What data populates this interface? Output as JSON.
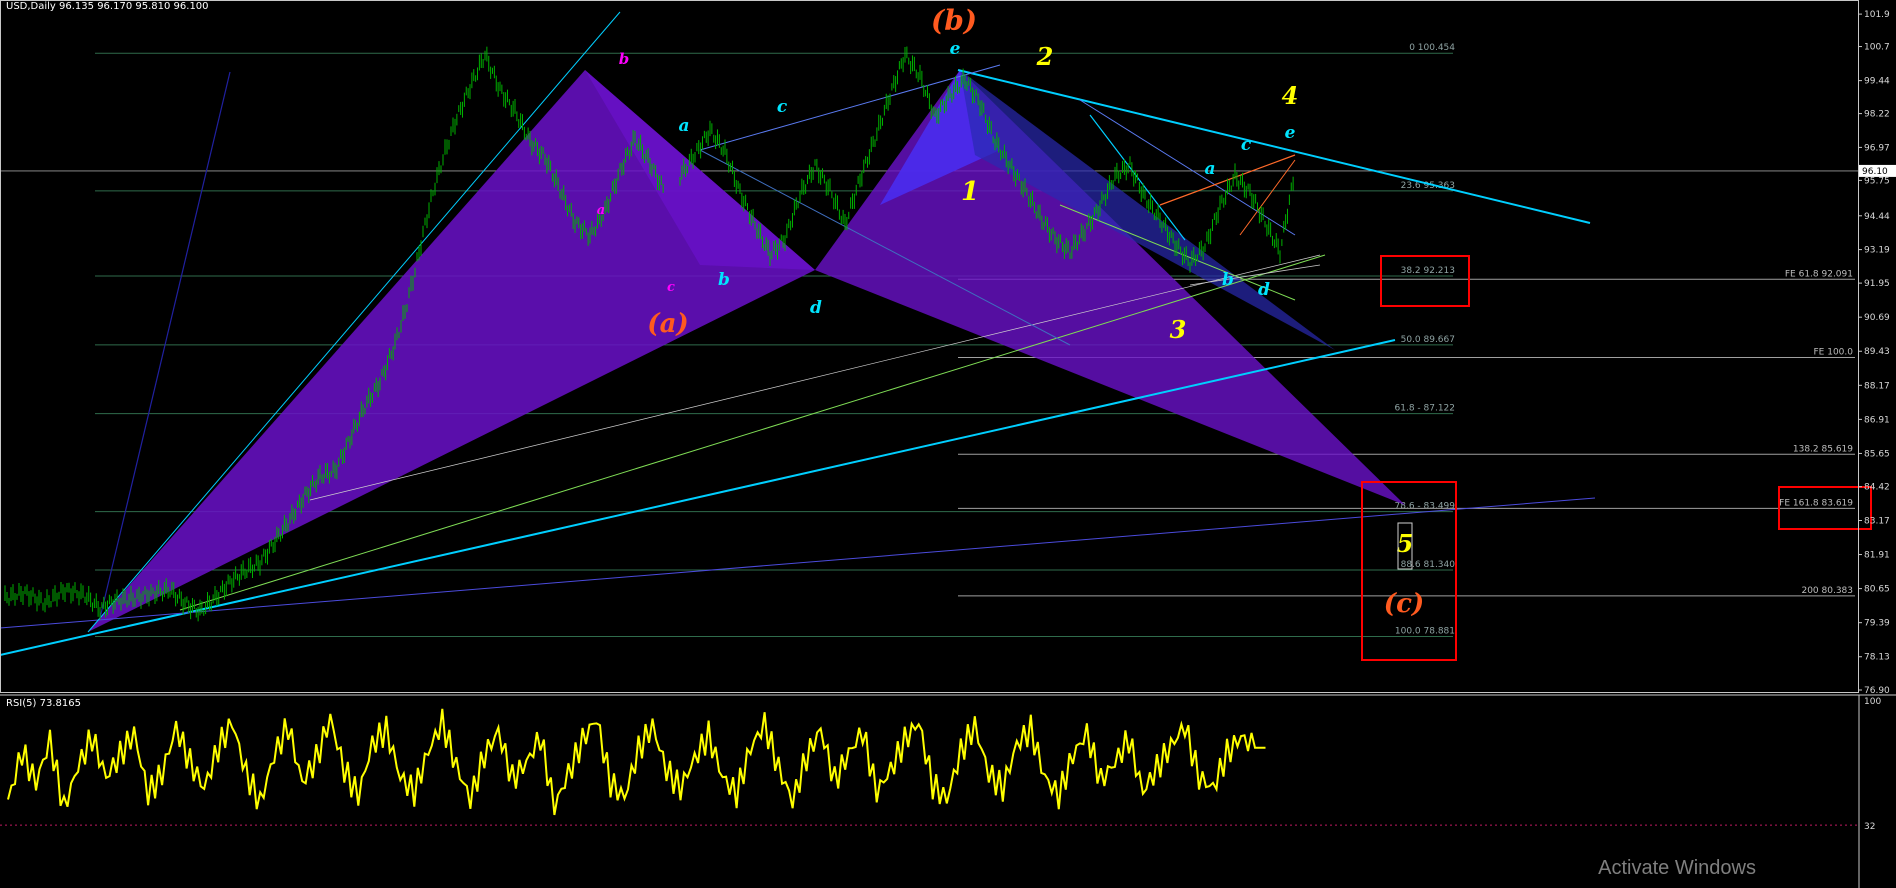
{
  "header": {
    "symbol_ohlc": "USD,Daily  96.135 96.170 95.810 96.100",
    "rsi_label": "RSI(5) 73.8165"
  },
  "watermark": "Activate Windows",
  "colors": {
    "background": "#000000",
    "candles": "#00b000",
    "rsi_line": "#ffff00",
    "wave_label_orange": "#ff5a1f",
    "wave_label_yellow": "#ffff00",
    "wave_label_cyan": "#00e5ff",
    "wave_label_magenta": "#ff00ff",
    "harmonic_fill_purple": "#6a11c9",
    "harmonic_fill_blue": "#4a2cf0",
    "trendline_cyan": "#00cfff",
    "highlight_box": "#ff0000"
  },
  "chart_data": [
    {
      "type": "line",
      "subtype": "candlestick price chart with Elliott wave and harmonic pattern annotations",
      "title": "USD,Daily",
      "ohlc": {
        "open": 96.135,
        "high": 96.17,
        "low": 95.81,
        "close": 96.1
      },
      "ylim": [
        76.9,
        102.2
      ],
      "y_tick_labels": [
        "101.9",
        "100.7",
        "99.44",
        "98.22",
        "96.97",
        "96.10",
        "95.75",
        "94.44",
        "93.19",
        "91.95",
        "90.69",
        "89.43",
        "88.17",
        "86.91",
        "85.65",
        "84.42",
        "83.17",
        "81.91",
        "80.65",
        "79.39",
        "78.13",
        "76.90"
      ],
      "current_price_label": "96.10",
      "series": [
        {
          "x_index": [
            0,
            20,
            40,
            60,
            80,
            95,
            110,
            130,
            150,
            165,
            180,
            195,
            210,
            225,
            240,
            255,
            270,
            285,
            300,
            315,
            330,
            345,
            360,
            375,
            390,
            400,
            410,
            420,
            430,
            440,
            450,
            465,
            480,
            495,
            510,
            525,
            540,
            555,
            570,
            585,
            600,
            615,
            630,
            645,
            660
          ],
          "values": [
            80.3,
            80.5,
            80.1,
            80.6,
            80.4,
            79.9,
            80.2,
            80.3,
            80.5,
            80.6,
            80.1,
            79.8,
            80.3,
            80.9,
            81.3,
            81.6,
            82.4,
            83.2,
            84.1,
            84.8,
            85.0,
            86.2,
            87.4,
            88.3,
            89.7,
            90.9,
            92.4,
            94.1,
            95.6,
            96.8,
            97.9,
            99.2,
            100.4,
            99.1,
            98.3,
            97.2,
            96.6,
            95.4,
            94.2,
            93.7,
            94.6,
            96.1,
            97.3,
            96.4,
            95.3
          ]
        },
        {
          "x_index": [
            675,
            690,
            705,
            720,
            735,
            750,
            765,
            780,
            795,
            810,
            825,
            840,
            855,
            870,
            885,
            900,
            915,
            930,
            945,
            960,
            975,
            990,
            1005,
            1020,
            1035,
            1050,
            1065,
            1080,
            1095,
            1110,
            1125,
            1140,
            1155,
            1170,
            1185,
            1200,
            1215,
            1230,
            1245,
            1260,
            1275,
            1290
          ],
          "values": [
            95.9,
            96.7,
            97.6,
            96.8,
            95.3,
            94.1,
            93.0,
            93.6,
            95.2,
            96.3,
            95.4,
            94.1,
            95.8,
            97.3,
            98.9,
            100.4,
            99.6,
            98.1,
            98.9,
            99.5,
            98.6,
            97.2,
            96.3,
            95.4,
            94.4,
            93.6,
            93.1,
            93.9,
            94.8,
            95.9,
            96.3,
            95.1,
            94.3,
            93.4,
            92.7,
            93.3,
            94.8,
            95.9,
            95.3,
            94.2,
            93.1,
            96.1
          ]
        }
      ],
      "fibonacci_levels": [
        {
          "label": "0 100.454",
          "value": 100.454
        },
        {
          "label": "23.6 95.363",
          "value": 95.363
        },
        {
          "label": "38.2 92.213",
          "value": 92.213
        },
        {
          "label": "50.0 89.667",
          "value": 89.667
        },
        {
          "label": "61.8 - 87.122",
          "value": 87.122
        },
        {
          "label": "78.6 - 83.499",
          "value": 83.499
        },
        {
          "label": "88.6 81.340",
          "value": 81.34
        },
        {
          "label": "100.0 78.881",
          "value": 78.881
        }
      ],
      "fib_extension_levels": [
        {
          "label": "FE 61.8 92.091",
          "value": 92.091
        },
        {
          "label": "FE 100.0",
          "value": 89.2
        },
        {
          "label": "138.2 85.619",
          "value": 85.619
        },
        {
          "label": "FE 161.8 83.619",
          "value": 83.619
        },
        {
          "label": "200 80.383",
          "value": 80.383
        }
      ],
      "wave_labels": [
        {
          "text": "(b)",
          "color": "orange"
        },
        {
          "text": "(a)",
          "color": "orange"
        },
        {
          "text": "(c)",
          "color": "orange"
        },
        {
          "text": "1",
          "color": "yellow"
        },
        {
          "text": "2",
          "color": "yellow"
        },
        {
          "text": "3",
          "color": "yellow"
        },
        {
          "text": "4",
          "color": "yellow"
        },
        {
          "text": "5",
          "color": "yellow"
        },
        {
          "text": "a",
          "color": "cyan"
        },
        {
          "text": "c",
          "color": "cyan"
        },
        {
          "text": "b",
          "color": "cyan"
        },
        {
          "text": "d",
          "color": "cyan"
        },
        {
          "text": "e",
          "color": "cyan"
        },
        {
          "text": "a",
          "color": "cyan"
        },
        {
          "text": "c",
          "color": "cyan"
        },
        {
          "text": "e",
          "color": "cyan"
        },
        {
          "text": "b",
          "color": "cyan"
        },
        {
          "text": "d",
          "color": "cyan"
        },
        {
          "text": "b",
          "color": "magenta"
        },
        {
          "text": "a",
          "color": "magenta"
        },
        {
          "text": "c",
          "color": "magenta"
        }
      ]
    },
    {
      "type": "line",
      "title": "RSI(5) 73.8165",
      "ylim": [
        0,
        100
      ],
      "y_tick_labels": [
        "100",
        "32"
      ],
      "reference_line": 32,
      "series": [
        {
          "values": [
            45,
            72,
            55,
            78,
            41,
            64,
            80,
            58,
            70,
            82,
            49,
            60,
            85,
            66,
            52,
            74,
            88,
            60,
            44,
            70,
            86,
            55,
            68,
            90,
            62,
            48,
            76,
            84,
            58,
            50,
            72,
            88,
            64,
            46,
            70,
            83,
            57,
            66,
            80,
            42,
            60,
            78,
            90,
            55,
            47,
            73,
            86,
            62,
            52,
            68,
            81,
            58,
            49,
            74,
            87,
            63,
            45,
            69,
            84,
            56,
            71,
            83,
            50,
            62,
            78,
            88,
            54,
            46,
            72,
            86,
            60,
            52,
            76,
            84,
            58,
            48,
            70,
            82,
            56,
            66,
            79,
            50,
            63,
            75,
            86,
            58,
            52,
            71,
            80,
            74
          ]
        }
      ]
    }
  ]
}
